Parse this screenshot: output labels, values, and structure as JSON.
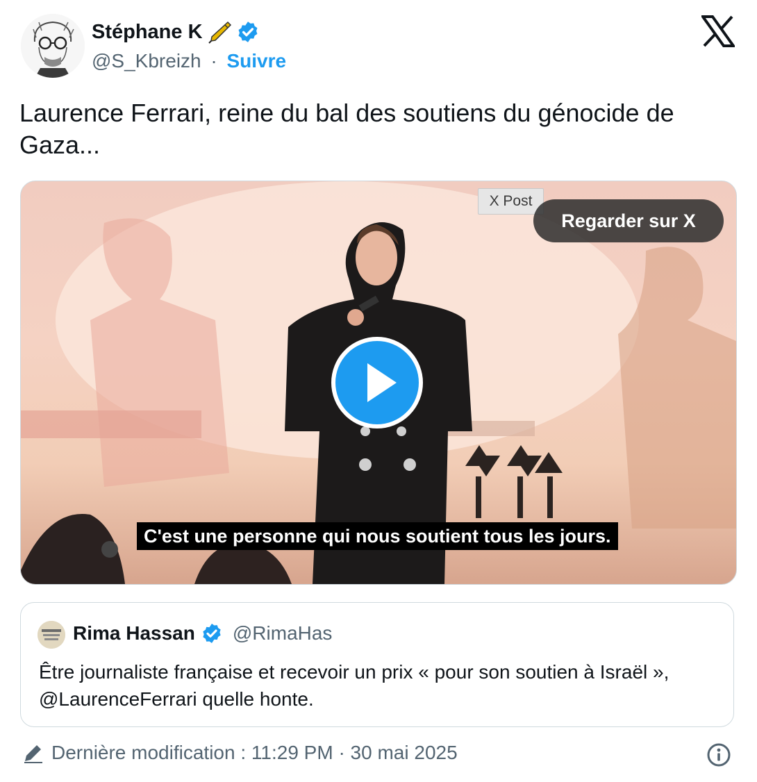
{
  "author": {
    "name": "Stéphane K",
    "handle": "@S_Kbreizh",
    "separator": "·",
    "follow_label": "Suivre",
    "emoji_icon": "pen-icon",
    "verified_color": "#1d9bf0"
  },
  "tweet": {
    "text": "Laurence Ferrari, reine du bal des soutiens du génocide de Gaza..."
  },
  "media": {
    "label": "X Post",
    "watch_label": "Regarder sur X",
    "subtitle": "C'est une personne qui nous soutient tous les jours."
  },
  "quoted_tweet": {
    "name": "Rima Hassan",
    "handle": "@RimaHas",
    "text": "Être journaliste française et recevoir un prix « pour son soutien à Israël », @LaurenceFerrari quelle honte."
  },
  "footer": {
    "edited_label": "Dernière modification : 11:29 PM · 30 mai 2025"
  },
  "colors": {
    "accent": "#1d9bf0",
    "secondary_text": "#536471",
    "border": "#cfd9de"
  }
}
